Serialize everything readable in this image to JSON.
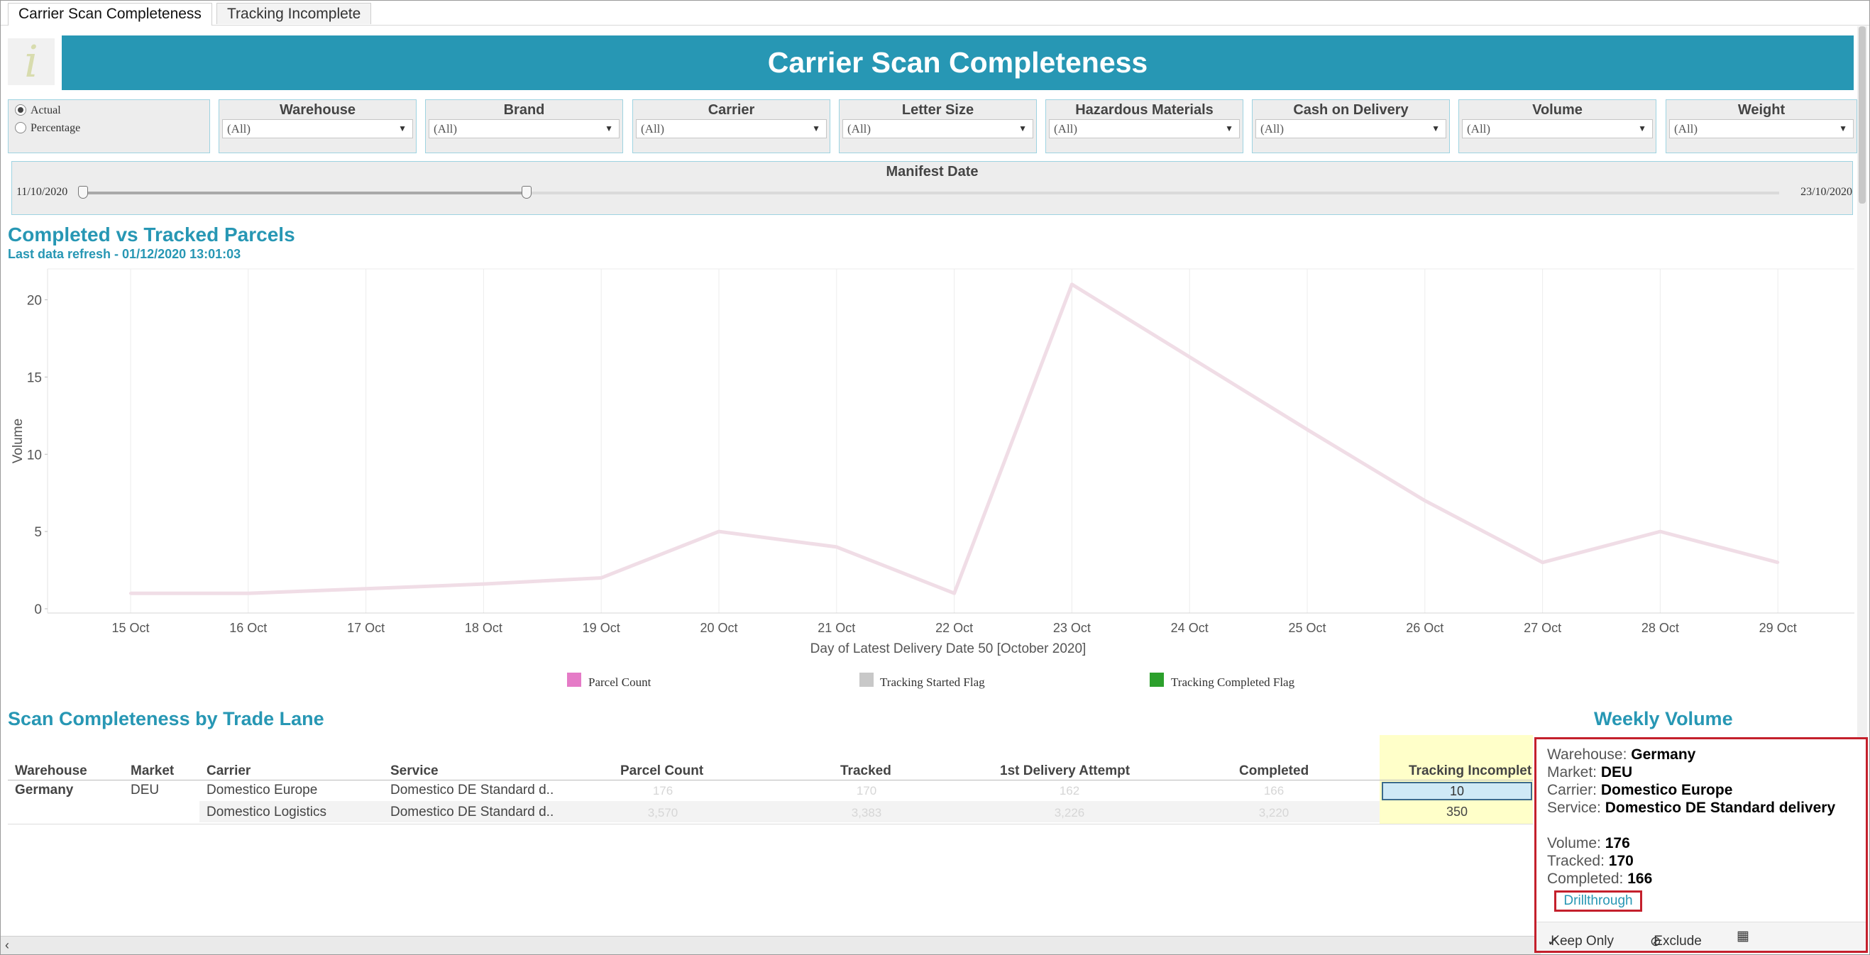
{
  "tabs": [
    "Carrier Scan Completeness",
    "Tracking Incomplete"
  ],
  "logo_glyph": "i",
  "banner_title": "Carrier Scan Completeness",
  "radio": {
    "options": [
      "Actual",
      "Percentage"
    ],
    "selected": "Actual"
  },
  "filters": [
    {
      "label": "Warehouse",
      "value": "(All)"
    },
    {
      "label": "Brand",
      "value": "(All)"
    },
    {
      "label": "Carrier",
      "value": "(All)"
    },
    {
      "label": "Letter Size",
      "value": "(All)"
    },
    {
      "label": "Hazardous Materials",
      "value": "(All)"
    },
    {
      "label": "Cash on Delivery",
      "value": "(All)"
    },
    {
      "label": "Volume",
      "value": "(All)"
    },
    {
      "label": "Weight",
      "value": "(All)"
    }
  ],
  "manifest": {
    "label": "Manifest Date",
    "start": "11/10/2020",
    "end": "23/10/2020"
  },
  "chart_section": {
    "title": "Completed vs Tracked Parcels",
    "subtitle": "Last data refresh - 01/12/2020 13:01:03"
  },
  "chart_data": {
    "type": "line",
    "categories": [
      "15 Oct",
      "16 Oct",
      "17 Oct",
      "18 Oct",
      "19 Oct",
      "20 Oct",
      "21 Oct",
      "22 Oct",
      "23 Oct",
      "24 Oct",
      "25 Oct",
      "26 Oct",
      "27 Oct",
      "28 Oct",
      "29 Oct"
    ],
    "series": [
      {
        "name": "Parcel Count",
        "values": [
          1,
          1,
          1.3,
          1.6,
          2,
          5,
          4,
          1,
          21,
          16.3,
          11.6,
          7,
          3,
          5,
          3
        ],
        "color": "#f0dde6"
      }
    ],
    "yticks": [
      0,
      5,
      10,
      15,
      20
    ],
    "ylim": [
      0,
      22
    ],
    "ylabel": "Volume",
    "xlabel": "Day of Latest Delivery Date 50 [October 2020]",
    "legend": [
      {
        "name": "Parcel Count",
        "color": "#e57bc7"
      },
      {
        "name": "Tracking Started Flag",
        "color": "#c8c8c8"
      },
      {
        "name": "Tracking Completed Flag",
        "color": "#2ca02c"
      }
    ],
    "grid": true
  },
  "table_section": {
    "title": "Scan Completeness by Trade Lane",
    "side_title": "Weekly Volume"
  },
  "table": {
    "headers": [
      "Warehouse",
      "Market",
      "Carrier",
      "Service",
      "Parcel Count",
      "Tracked",
      "1st Delivery Attempt",
      "Completed",
      "Tracking Incomplet"
    ],
    "rows": [
      {
        "warehouse": "Germany",
        "market": "DEU",
        "carrier": "Domestico Europe",
        "service": "Domestico DE Standard d..",
        "parcel_count": "176",
        "tracked": "170",
        "first_attempt": "162",
        "completed": "166",
        "incomplete": "10"
      },
      {
        "warehouse": "",
        "market": "",
        "carrier": "Domestico Logistics",
        "service": "Domestico DE Standard d..",
        "parcel_count": "3,570",
        "tracked": "3,383",
        "first_attempt": "3,226",
        "completed": "3,220",
        "incomplete": "350"
      }
    ]
  },
  "tooltip": {
    "warehouse_label": "Warehouse:",
    "warehouse": "Germany",
    "market_label": "Market:",
    "market": "DEU",
    "carrier_label": "Carrier:",
    "carrier": "Domestico Europe",
    "service_label": "Service:",
    "service": "Domestico DE Standard delivery",
    "volume_label": "Volume:",
    "volume": "176",
    "tracked_label": "Tracked:",
    "tracked": "170",
    "completed_label": "Completed:",
    "completed": "166",
    "drillthrough": "Drillthrough",
    "keep_only": "Keep Only",
    "exclude": "Exclude",
    "keep_icon": "check-icon",
    "exclude_icon": "prohibited-icon",
    "view_icon": "grid-view-icon"
  },
  "colors": {
    "accent": "#2797b4",
    "selection_border": "#c4202c",
    "highlight": "#ffffc9"
  }
}
